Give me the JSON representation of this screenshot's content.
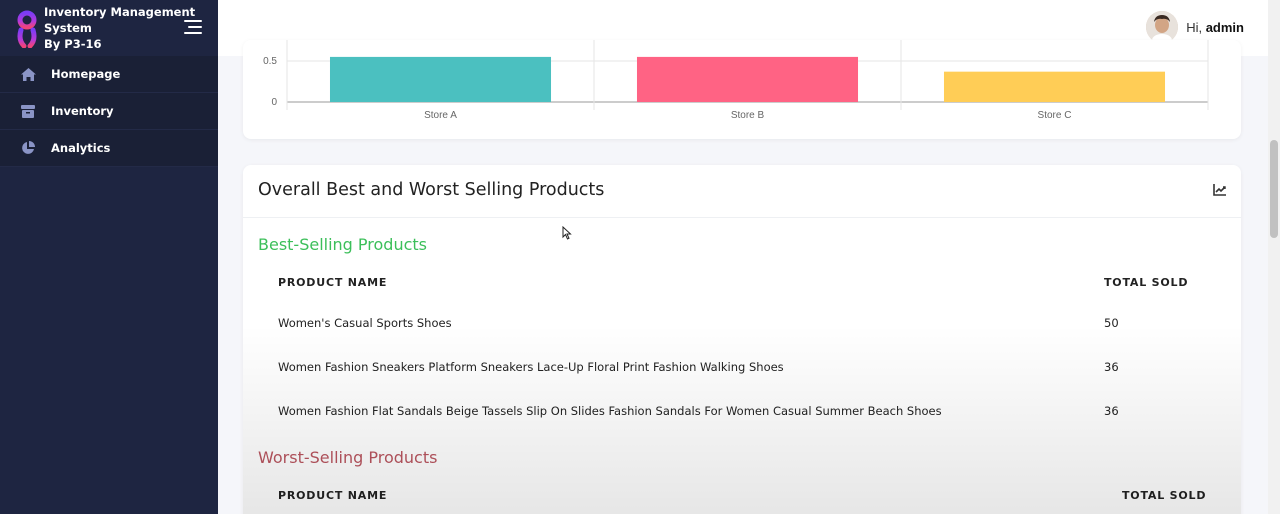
{
  "brand": {
    "line1": "Inventory Management",
    "line2": "System",
    "line3": "By P3-16"
  },
  "sidebar": {
    "items": [
      {
        "label": "Homepage",
        "icon": "home-icon"
      },
      {
        "label": "Inventory",
        "icon": "inventory-icon"
      },
      {
        "label": "Analytics",
        "icon": "pie-chart-icon"
      }
    ]
  },
  "header": {
    "greeting": "Hi,",
    "username": "admin"
  },
  "chart_data": {
    "type": "bar",
    "categories": [
      "Store A",
      "Store B",
      "Store C"
    ],
    "values": [
      0.55,
      0.55,
      0.37
    ],
    "colors": [
      "#4bc0c0",
      "#ff6384",
      "#ffcd56"
    ],
    "yticks": [
      "0",
      "0.5"
    ],
    "ylim": [
      0,
      0.55
    ]
  },
  "products": {
    "title": "Overall Best and Worst Selling Products",
    "best": {
      "title": "Best-Selling Products",
      "columns": [
        "PRODUCT NAME",
        "TOTAL SOLD"
      ],
      "rows": [
        {
          "name": "Women's Casual Sports Shoes",
          "sold": "50"
        },
        {
          "name": "Women Fashion Sneakers Platform Sneakers Lace-Up Floral Print Fashion Walking Shoes",
          "sold": "36"
        },
        {
          "name": "Women Fashion Flat Sandals Beige Tassels Slip On Slides Fashion Sandals For Women Casual Summer Beach Shoes",
          "sold": "36"
        }
      ]
    },
    "worst": {
      "title": "Worst-Selling Products",
      "columns": [
        "PRODUCT NAME",
        "TOTAL SOLD"
      ]
    }
  }
}
